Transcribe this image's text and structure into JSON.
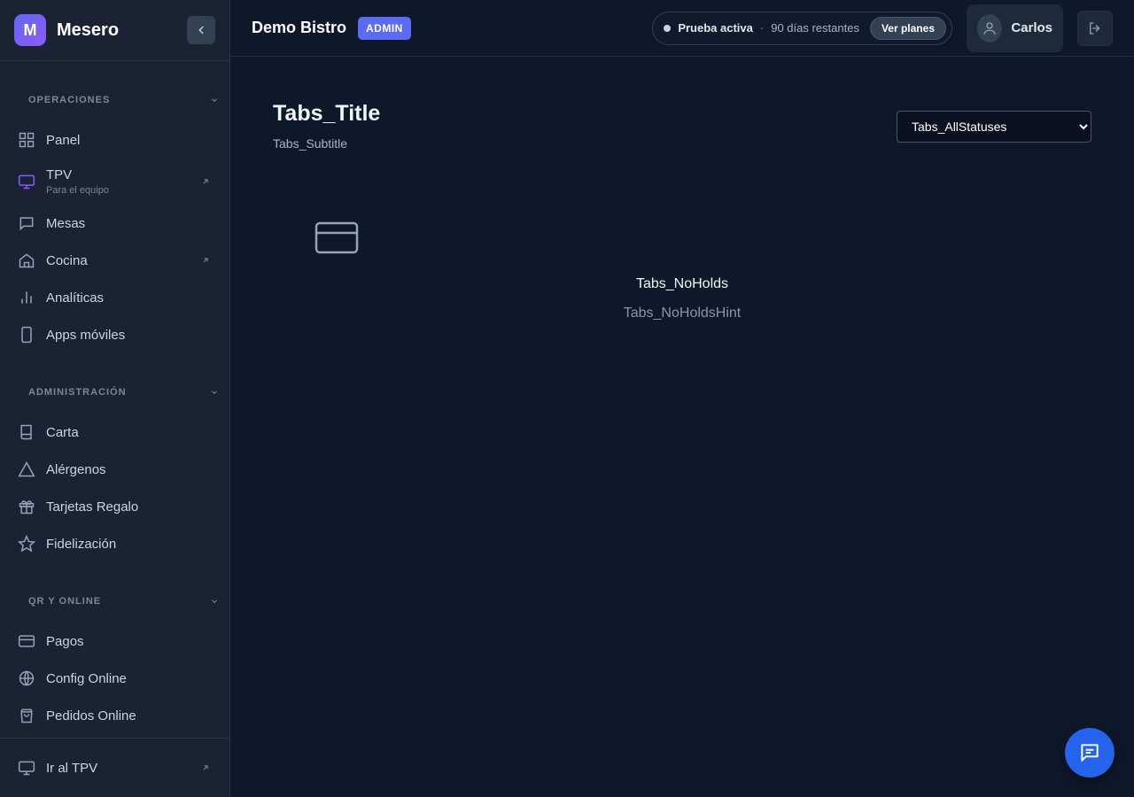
{
  "brand": {
    "logo_letter": "M",
    "name": "Mesero"
  },
  "sidebar": {
    "sections": [
      {
        "title": "OPERACIONES",
        "items": [
          {
            "label": "Panel"
          },
          {
            "label": "TPV",
            "sub": "Para el equipo"
          },
          {
            "label": "Mesas"
          },
          {
            "label": "Cocina"
          },
          {
            "label": "Analíticas"
          },
          {
            "label": "Apps móviles"
          }
        ]
      },
      {
        "title": "ADMINISTRACIÓN",
        "items": [
          {
            "label": "Carta"
          },
          {
            "label": "Alérgenos"
          },
          {
            "label": "Tarjetas Regalo"
          },
          {
            "label": "Fidelización"
          }
        ]
      },
      {
        "title": "QR Y ONLINE",
        "items": [
          {
            "label": "Pagos"
          },
          {
            "label": "Config Online"
          },
          {
            "label": "Pedidos Online"
          }
        ]
      }
    ],
    "footer": {
      "label": "Ir al TPV"
    }
  },
  "header": {
    "restaurant": "Demo Bistro",
    "role_badge": "ADMIN",
    "trial": {
      "label": "Prueba activa",
      "separator": "·",
      "days": "90 días restantes",
      "button": "Ver planes"
    },
    "user": {
      "name": "Carlos"
    }
  },
  "main": {
    "title": "Tabs_Title",
    "subtitle": "Tabs_Subtitle",
    "filter": {
      "selected": "Tabs_AllStatuses"
    },
    "empty": {
      "title": "Tabs_NoHolds",
      "hint": "Tabs_NoHoldsHint"
    }
  },
  "colors": {
    "accent": "#6366f1",
    "badge": "#5b6cf2",
    "chat": "#2563eb",
    "background": "#0f172a",
    "sidebar": "#1a2233"
  }
}
